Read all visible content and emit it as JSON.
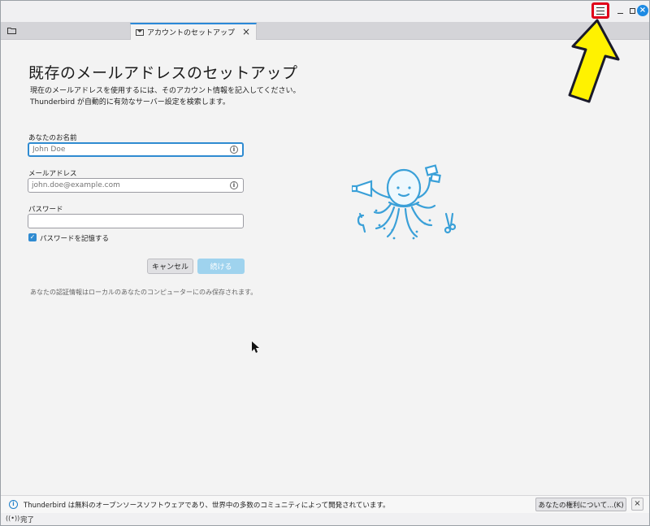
{
  "window": {
    "menu_icon": "hamburger-menu-icon",
    "minimize_icon": "minimize-icon",
    "maximize_icon": "maximize-icon",
    "close_icon": "close-icon",
    "close_glyph": "×"
  },
  "tabs": {
    "folder_icon": "folder-icon",
    "active": {
      "label": "アカウントのセットアップ",
      "icon": "envelope-icon",
      "close": "×"
    }
  },
  "setup": {
    "title": "既存のメールアドレスのセットアップ",
    "description_line1": "現在のメールアドレスを使用するには、そのアカウント情報を記入してください。",
    "description_line2": "Thunderbird が自動的に有効なサーバー設定を検索します。",
    "name_label": "あなたのお名前",
    "name_placeholder": "John Doe",
    "email_label": "メールアドレス",
    "email_placeholder": "john.doe@example.com",
    "password_label": "パスワード",
    "password_value": "",
    "info_glyph": "i",
    "remember_label": "パスワードを記憶する",
    "remember_checked": true,
    "checkmark": "✓",
    "cancel_label": "キャンセル",
    "continue_label": "続ける",
    "local_note": "あなたの認証情報はローカルのあなたのコンピューターにのみ保存されます。"
  },
  "notification": {
    "icon": "info-icon",
    "icon_glyph": "i",
    "text": "Thunderbird は無料のオープンソースソフトウェアであり、世界中の多数のコミュニティによって開発されています。",
    "rights_button": "あなたの権利について...(K)",
    "close": "×"
  },
  "status": {
    "icon": "connection-icon",
    "icon_glyph": "((•))",
    "text": "完了"
  },
  "colors": {
    "accent": "#2f8bd1",
    "highlight_box": "#e0001a",
    "arrow_fill": "#fff200",
    "continue_disabled": "#9fd3ee"
  }
}
